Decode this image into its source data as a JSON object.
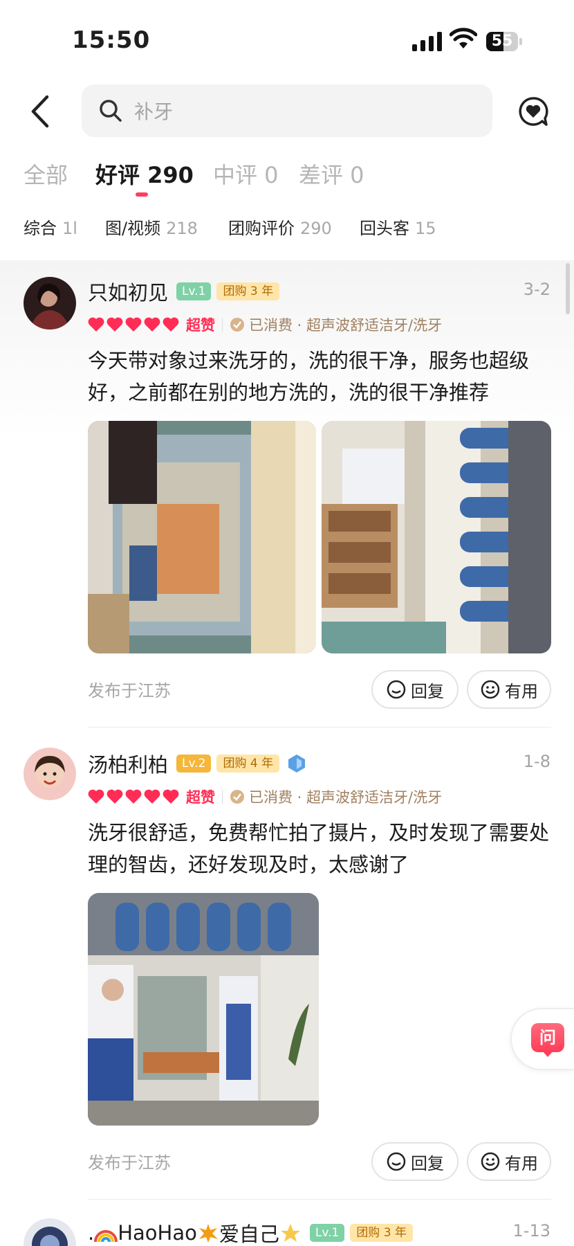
{
  "status_bar": {
    "time": "15:50",
    "battery": "55",
    "battery_level": 0.55
  },
  "search": {
    "placeholder": "补牙"
  },
  "tabs": [
    {
      "label": "全部"
    },
    {
      "label": "好评 290"
    },
    {
      "label": "中评 0"
    },
    {
      "label": "差评 0"
    }
  ],
  "filters": [
    {
      "label": "综合",
      "count": "1l"
    },
    {
      "label": "图/视频",
      "count": "218"
    },
    {
      "label": "团购评价",
      "count": "290"
    },
    {
      "label": "回头客",
      "count": "15"
    }
  ],
  "reviews": [
    {
      "user": "只如初见",
      "level": "Lv.1",
      "group_badge": "团购 3 年",
      "date": "3-2",
      "rating_label": "超赞",
      "consume_info": "已消费 · 超声波舒适洁牙/洗牙",
      "content": "今天带对象过来洗牙的，洗的很干净，服务也超级好，之前都在别的地方洗的，洗的很干净推荐",
      "location": "发布于江苏",
      "reply_label": "回复",
      "useful_label": "有用"
    },
    {
      "user": "汤柏利柏",
      "level": "Lv.2",
      "group_badge": "团购 4 年",
      "date": "1-8",
      "rating_label": "超赞",
      "consume_info": "已消费 · 超声波舒适洁牙/洗牙",
      "content": "洗牙很舒适，免费帮忙拍了摄片，及时发现了需要处理的智齿，还好发现及时，太感谢了",
      "location": "发布于江苏",
      "reply_label": "回复",
      "useful_label": "有用"
    },
    {
      "user_prefix": ".",
      "user_main": "HaoHao",
      "user_suffix": "爱自己",
      "level": "Lv.1",
      "group_badge": "团购 3 年",
      "date": "1-13"
    }
  ],
  "ask_button": {
    "label": "问"
  },
  "colors": {
    "accent": "#ff3e5f",
    "lv1": "#7fd1a6",
    "lv2": "#f5b63a"
  }
}
